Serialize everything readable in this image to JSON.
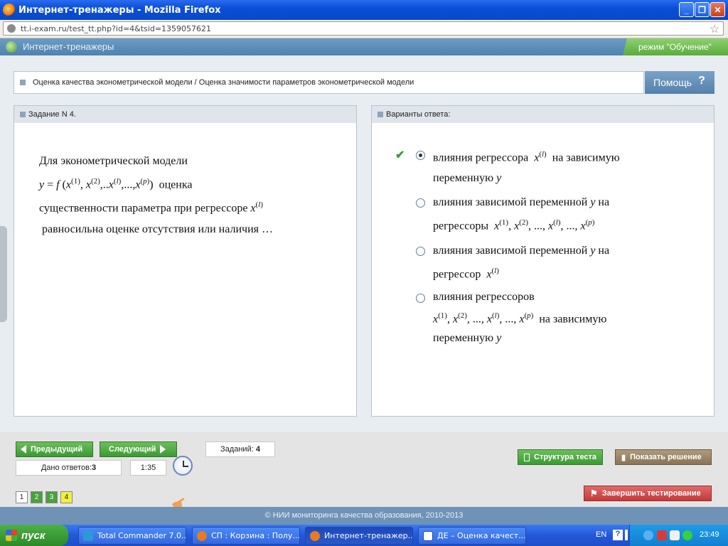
{
  "window": {
    "title": "Интернет-тренажеры - Mozilla Firefox",
    "btn_min": "_",
    "btn_max": "❐",
    "btn_close": "✕"
  },
  "browser": {
    "url": "tt.i-exam.ru/test_tt.php?id=4&tsid=1359057621",
    "star": "☆"
  },
  "app": {
    "title": "Интернет-тренажеры",
    "mode": "режим \"Обучение\""
  },
  "topic": {
    "text": "Оценка качества эконометрической модели / Оценка значимости параметров эконометрической модели",
    "help_label": "Помощь",
    "help_q": "?"
  },
  "task": {
    "header": "Задание N 4.",
    "q_line1": "Для эконометрической модели",
    "q_formula_y": "y",
    "q_formula": "= f (x",
    "q_line2_tail": "оценка",
    "q_line3": "существенности параметра при регрессоре",
    "q_line4": "равносильна оценке отсутствия или наличия …"
  },
  "answers": {
    "header": "Варианты ответа:",
    "options": [
      {
        "line1": "влияния регрессора",
        "line1b": "на зависимую",
        "line2": "переменную",
        "var": "y",
        "selected": true
      },
      {
        "line1": "влияния зависимой переменной",
        "var": "y",
        "line1b": "на",
        "line2": "регрессоры",
        "selected": false
      },
      {
        "line1": "влияния зависимой переменной",
        "var": "y",
        "line1b": "на",
        "line2": "регрессор",
        "selected": false
      },
      {
        "line1": "влияния регрессоров",
        "line2b": "на зависимую",
        "line3": "переменную",
        "var": "y",
        "selected": false
      }
    ]
  },
  "nav": {
    "prev": "Предыдущий",
    "next": "Следующий",
    "tasks_label": "Заданий:",
    "tasks_count": "4",
    "answers_label": "Дано ответов:",
    "answers_count": "3",
    "timer": "1:35",
    "pages": [
      "1",
      "2",
      "3",
      "4"
    ],
    "structure_btn": "Структура теста",
    "solution_btn": "Показать решение",
    "finish_btn": "Завершить тестирование"
  },
  "footer": {
    "copyright": "© НИИ мониторинга качества образования, 2010-2013"
  },
  "taskbar": {
    "start": "пуск",
    "tasks": [
      "Total Commander 7.0...",
      "СП : Корзина : Полу...",
      "Интернет-тренажер...",
      "ДЕ – Оценка качест..."
    ],
    "lang": "EN",
    "time": "23:49"
  },
  "colors": {
    "accent_green": "#5aac3c",
    "app_bar": "#5f8fba",
    "taskbar_blue": "#2458d8"
  }
}
